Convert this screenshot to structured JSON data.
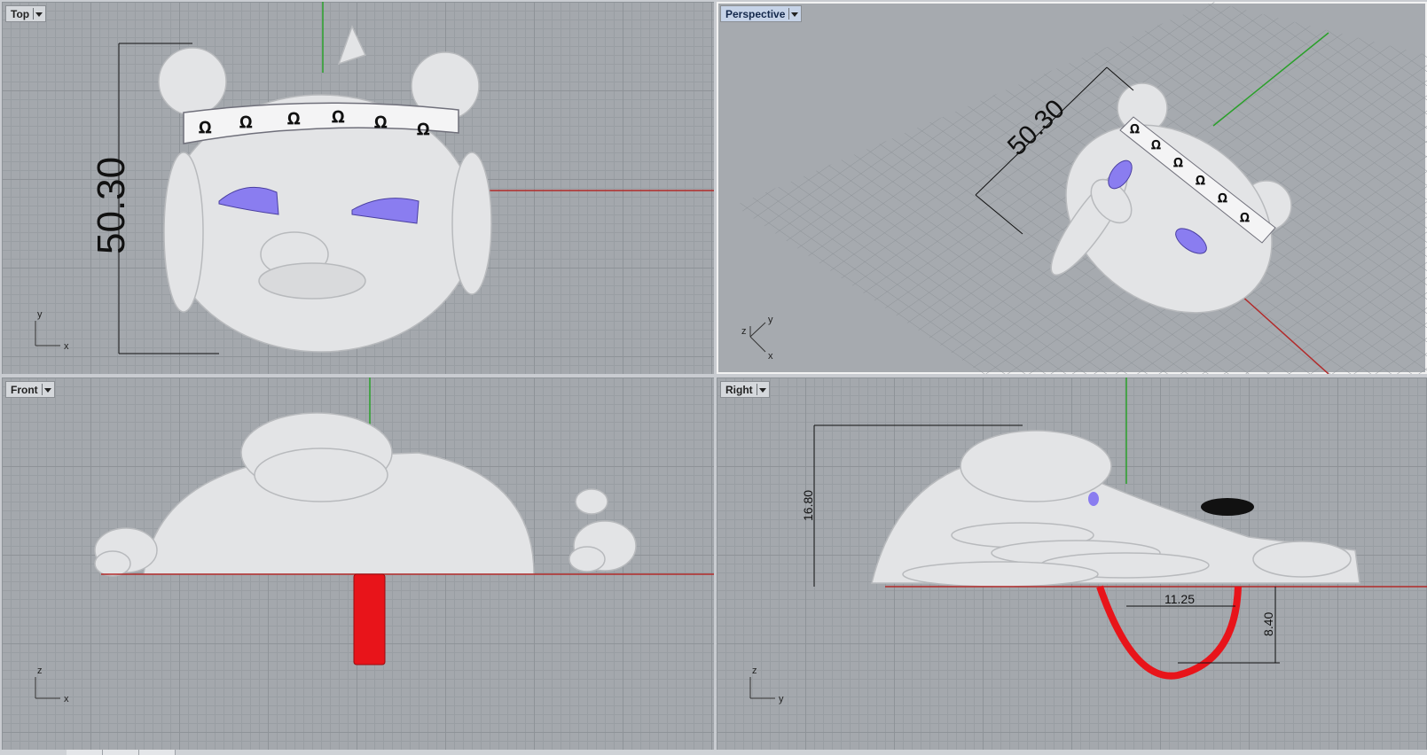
{
  "viewports": {
    "top": {
      "label": "Top",
      "dimension": "50.30",
      "axis_a": "y",
      "axis_b": "x"
    },
    "perspective": {
      "label": "Perspective",
      "dimension": "50.30",
      "axis_z": "z",
      "axis_a": "y",
      "axis_b": "x"
    },
    "front": {
      "label": "Front",
      "axis_a": "z",
      "axis_b": "x"
    },
    "right": {
      "label": "Right",
      "dim_height": "16.80",
      "dim_width": "11.25",
      "dim_depth": "8.40",
      "axis_a": "z",
      "axis_b": "y"
    }
  },
  "colors": {
    "model": "#e3e4e6",
    "x_axis": "#b22a2a",
    "y_axis": "#2aa02a",
    "bail": "#e8141a",
    "eyes": "#8a7df0"
  }
}
